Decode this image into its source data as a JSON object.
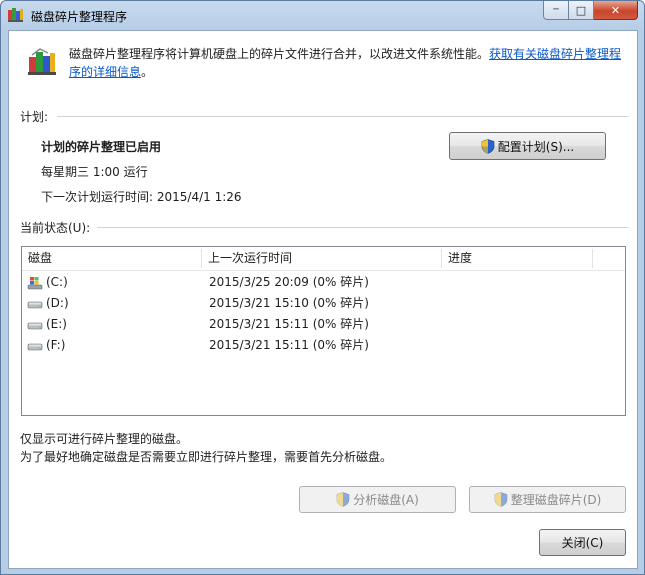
{
  "window": {
    "title": "磁盘碎片整理程序",
    "caption": {
      "minimize": "─",
      "maximize": "□",
      "close": "✕"
    }
  },
  "header": {
    "description": "磁盘碎片整理程序将计算机硬盘上的碎片文件进行合并，以改进文件系统性能。",
    "link_line1": "获取有关磁盘碎片整理程",
    "link_line2": "序的详细信息",
    "link_suffix": "。"
  },
  "schedule": {
    "group_label": "计划:",
    "status": "计划的碎片整理已启用",
    "frequency": "每星期三  1:00 运行",
    "next_run": "下一次计划运行时间: 2015/4/1 1:26",
    "configure_button": "配置计划(S)..."
  },
  "current_status": {
    "group_label": "当前状态(U):",
    "columns": [
      "磁盘",
      "上一次运行时间",
      "进度"
    ],
    "rows": [
      {
        "disk": "(C:)",
        "last_run": "2015/3/25 20:09 (0% 碎片)",
        "icon": "windows-drive-icon"
      },
      {
        "disk": "(D:)",
        "last_run": "2015/3/21 15:10 (0% 碎片)",
        "icon": "hard-drive-icon"
      },
      {
        "disk": "(E:)",
        "last_run": "2015/3/21 15:11 (0% 碎片)",
        "icon": "hard-drive-icon"
      },
      {
        "disk": "(F:)",
        "last_run": "2015/3/21 15:11 (0% 碎片)",
        "icon": "hard-drive-icon"
      }
    ]
  },
  "notes": {
    "line1": "仅显示可进行碎片整理的磁盘。",
    "line2": "为了最好地确定磁盘是否需要立即进行碎片整理，需要首先分析磁盘。"
  },
  "actions": {
    "analyze": "分析磁盘(A)",
    "defragment": "整理磁盘碎片(D)",
    "close": "关闭(C)"
  },
  "colors": {
    "link": "#0a58c9",
    "title_gradient": "#c7daee",
    "close_button": "#c9462c"
  }
}
